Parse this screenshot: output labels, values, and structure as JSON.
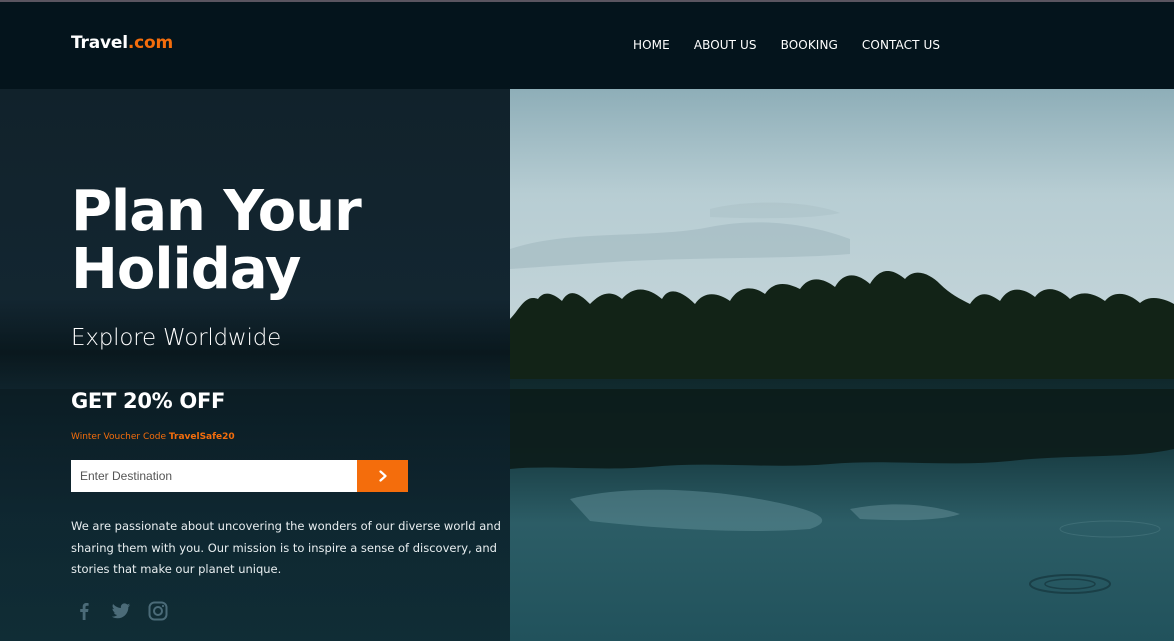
{
  "header": {
    "logo_main": "Travel",
    "logo_accent": ".com",
    "nav": [
      "HOME",
      "ABOUT US",
      "BOOKING",
      "CONTACT US"
    ]
  },
  "hero": {
    "title_line1": "Plan Your",
    "title_line2": "Holiday",
    "subtitle": "Explore Worldwide",
    "offer": "GET 20% OFF",
    "voucher_label": "Winter Voucher Code ",
    "voucher_code": "TravelSafe20",
    "search_placeholder": "Enter Destination",
    "description": "We are passionate about uncovering the wonders of our diverse world and sharing them with you. Our mission is to inspire a sense of discovery, and stories that make our planet unique."
  },
  "socials": [
    "facebook-icon",
    "twitter-icon",
    "instagram-icon"
  ],
  "colors": {
    "accent": "#f46d0c",
    "header_bg": "#04141c",
    "panel_bg": "#11222b"
  }
}
